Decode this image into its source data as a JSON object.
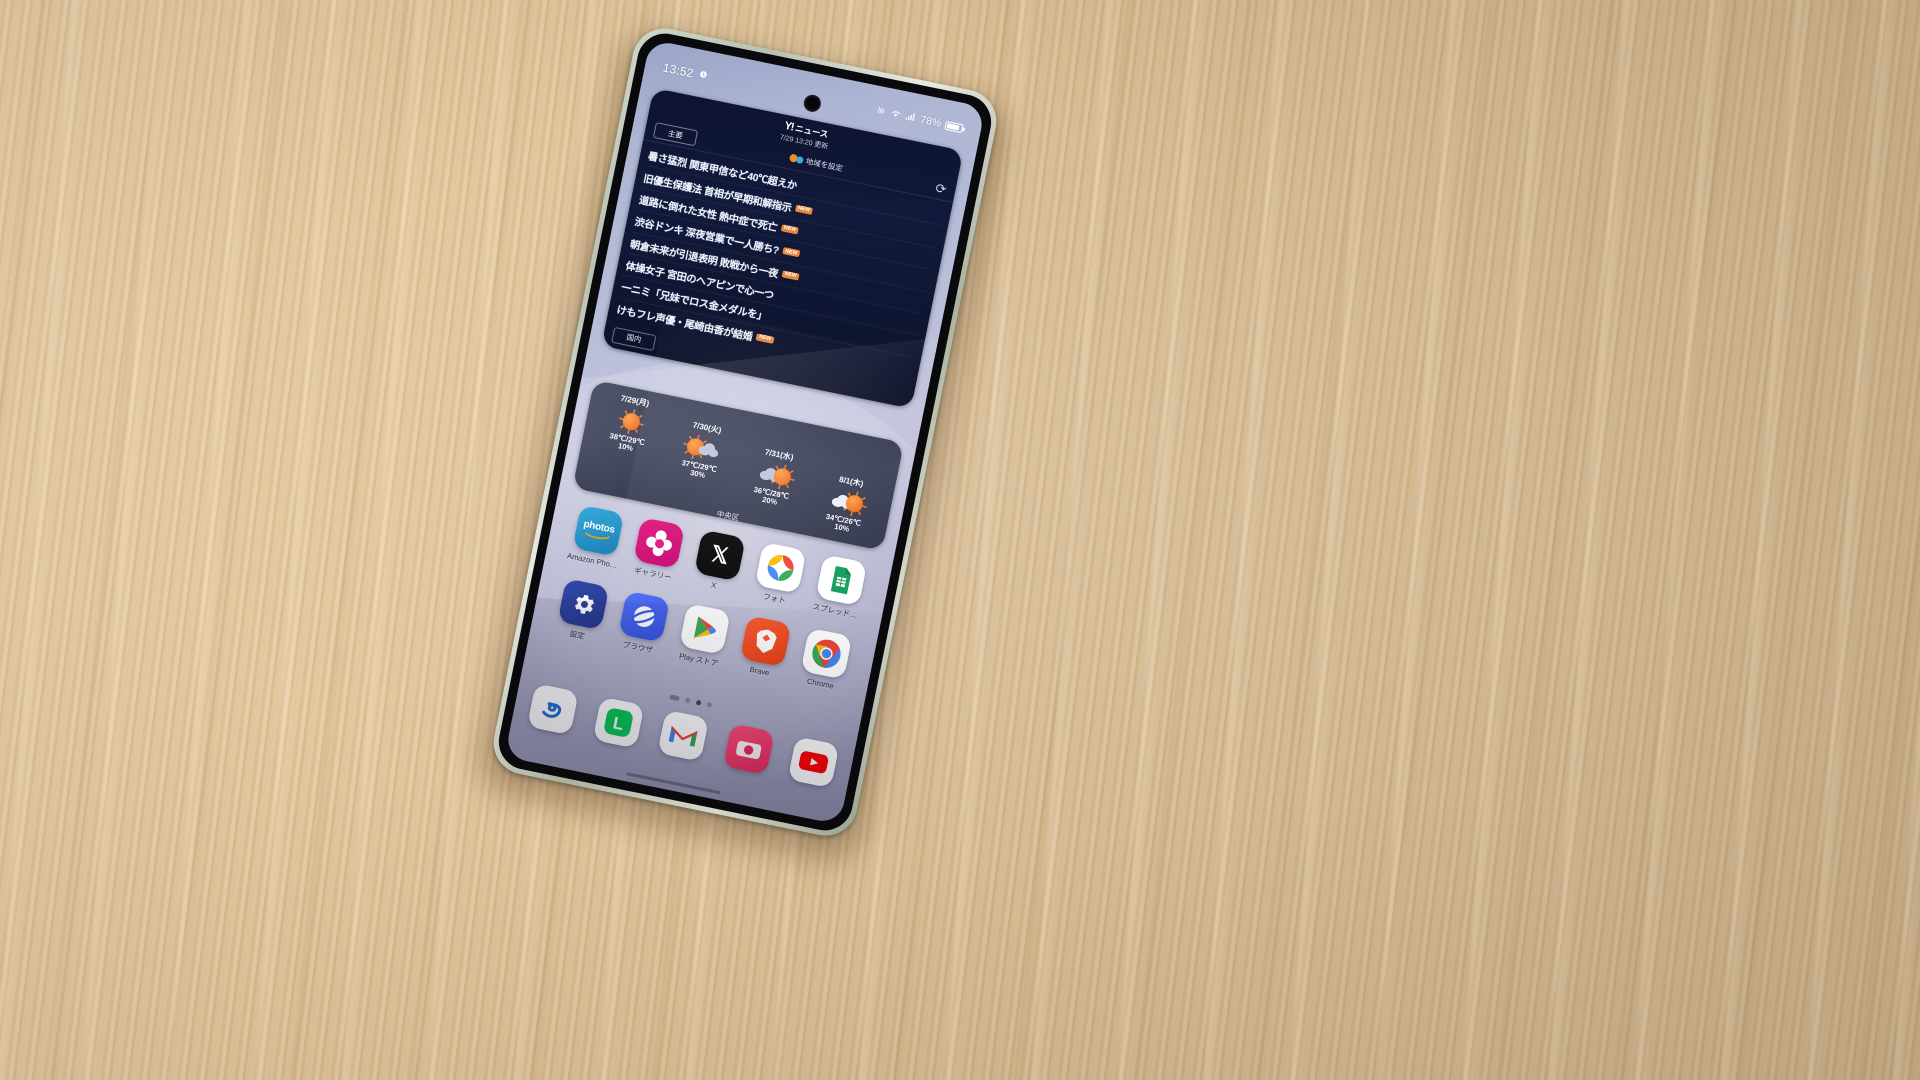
{
  "statusbar": {
    "time": "13:52",
    "left_icons": [
      "alarm-icon"
    ],
    "right": {
      "signal_label": "nfc-icon",
      "wifi": "wifi-icon",
      "signal": "signal-icon",
      "battery_pct": "78%"
    }
  },
  "news_widget": {
    "brand_mark": "Y!",
    "brand_name": "ニュース",
    "updated": "7/29 13:20 更新",
    "tab_label": "主要",
    "region_button": "地域を設定",
    "refresh_icon": "refresh-icon",
    "footer_tab": "国内",
    "items": [
      {
        "text": "暑さ猛烈 関東甲信など40℃超えか",
        "badge": ""
      },
      {
        "text": "旧優生保護法 首相が早期和解指示",
        "badge": "NEW"
      },
      {
        "text": "道路に倒れた女性 熱中症で死亡",
        "badge": "NEW"
      },
      {
        "text": "渋谷ドンキ 深夜営業で一人勝ち?",
        "badge": "NEW"
      },
      {
        "text": "朝倉未来が引退表明 敗戦から一夜",
        "badge": "NEW"
      },
      {
        "text": "体操女子 宮田のヘアピンで心一つ",
        "badge": ""
      },
      {
        "text": "一ニミ「兄妹でロス金メダルを」",
        "badge": ""
      },
      {
        "text": "けもフレ声優・尾崎由香が結婚",
        "badge": "NEW"
      }
    ]
  },
  "weather_widget": {
    "location": "中央区",
    "days": [
      {
        "date": "7/29(月)",
        "icon": "sunny",
        "high": "38℃",
        "low": "29℃",
        "pop": "10%"
      },
      {
        "date": "7/30(火)",
        "icon": "sunny-cloudy",
        "high": "37℃",
        "low": "29℃",
        "pop": "30%"
      },
      {
        "date": "7/31(水)",
        "icon": "cloudy-sunny",
        "high": "36℃",
        "low": "28℃",
        "pop": "20%"
      },
      {
        "date": "8/1(木)",
        "icon": "cloudy-sunny",
        "high": "34℃",
        "low": "26℃",
        "pop": "10%"
      }
    ]
  },
  "home": {
    "row1": [
      {
        "label": "Amazon Pho…",
        "icon": "amazon-photos-icon"
      },
      {
        "label": "ギャラリー",
        "icon": "gallery-icon"
      },
      {
        "label": "X",
        "icon": "x-icon"
      },
      {
        "label": "フォト",
        "icon": "google-photos-icon"
      },
      {
        "label": "スプレッド…",
        "icon": "google-sheets-icon"
      }
    ],
    "row2": [
      {
        "label": "設定",
        "icon": "settings-gear-icon"
      },
      {
        "label": "ブラウザ",
        "icon": "samsung-internet-icon"
      },
      {
        "label": "Play ストア",
        "icon": "play-store-icon"
      },
      {
        "label": "Brave",
        "icon": "brave-lion-icon"
      },
      {
        "label": "Chrome",
        "icon": "chrome-icon"
      }
    ],
    "page_dots": {
      "count": 4,
      "active_index": 2
    },
    "dock": [
      {
        "label": "sbi",
        "icon": "sbi-icon"
      },
      {
        "label": "line",
        "icon": "line-icon"
      },
      {
        "label": "gmail",
        "icon": "gmail-icon"
      },
      {
        "label": "camera",
        "icon": "camera-icon"
      },
      {
        "label": "youtube",
        "icon": "youtube-icon"
      }
    ]
  },
  "colors": {
    "news_bg": "#0f1633",
    "weather_bg": "#343a52",
    "badge": "#e8873a",
    "accent_sun": "#f0701c"
  }
}
